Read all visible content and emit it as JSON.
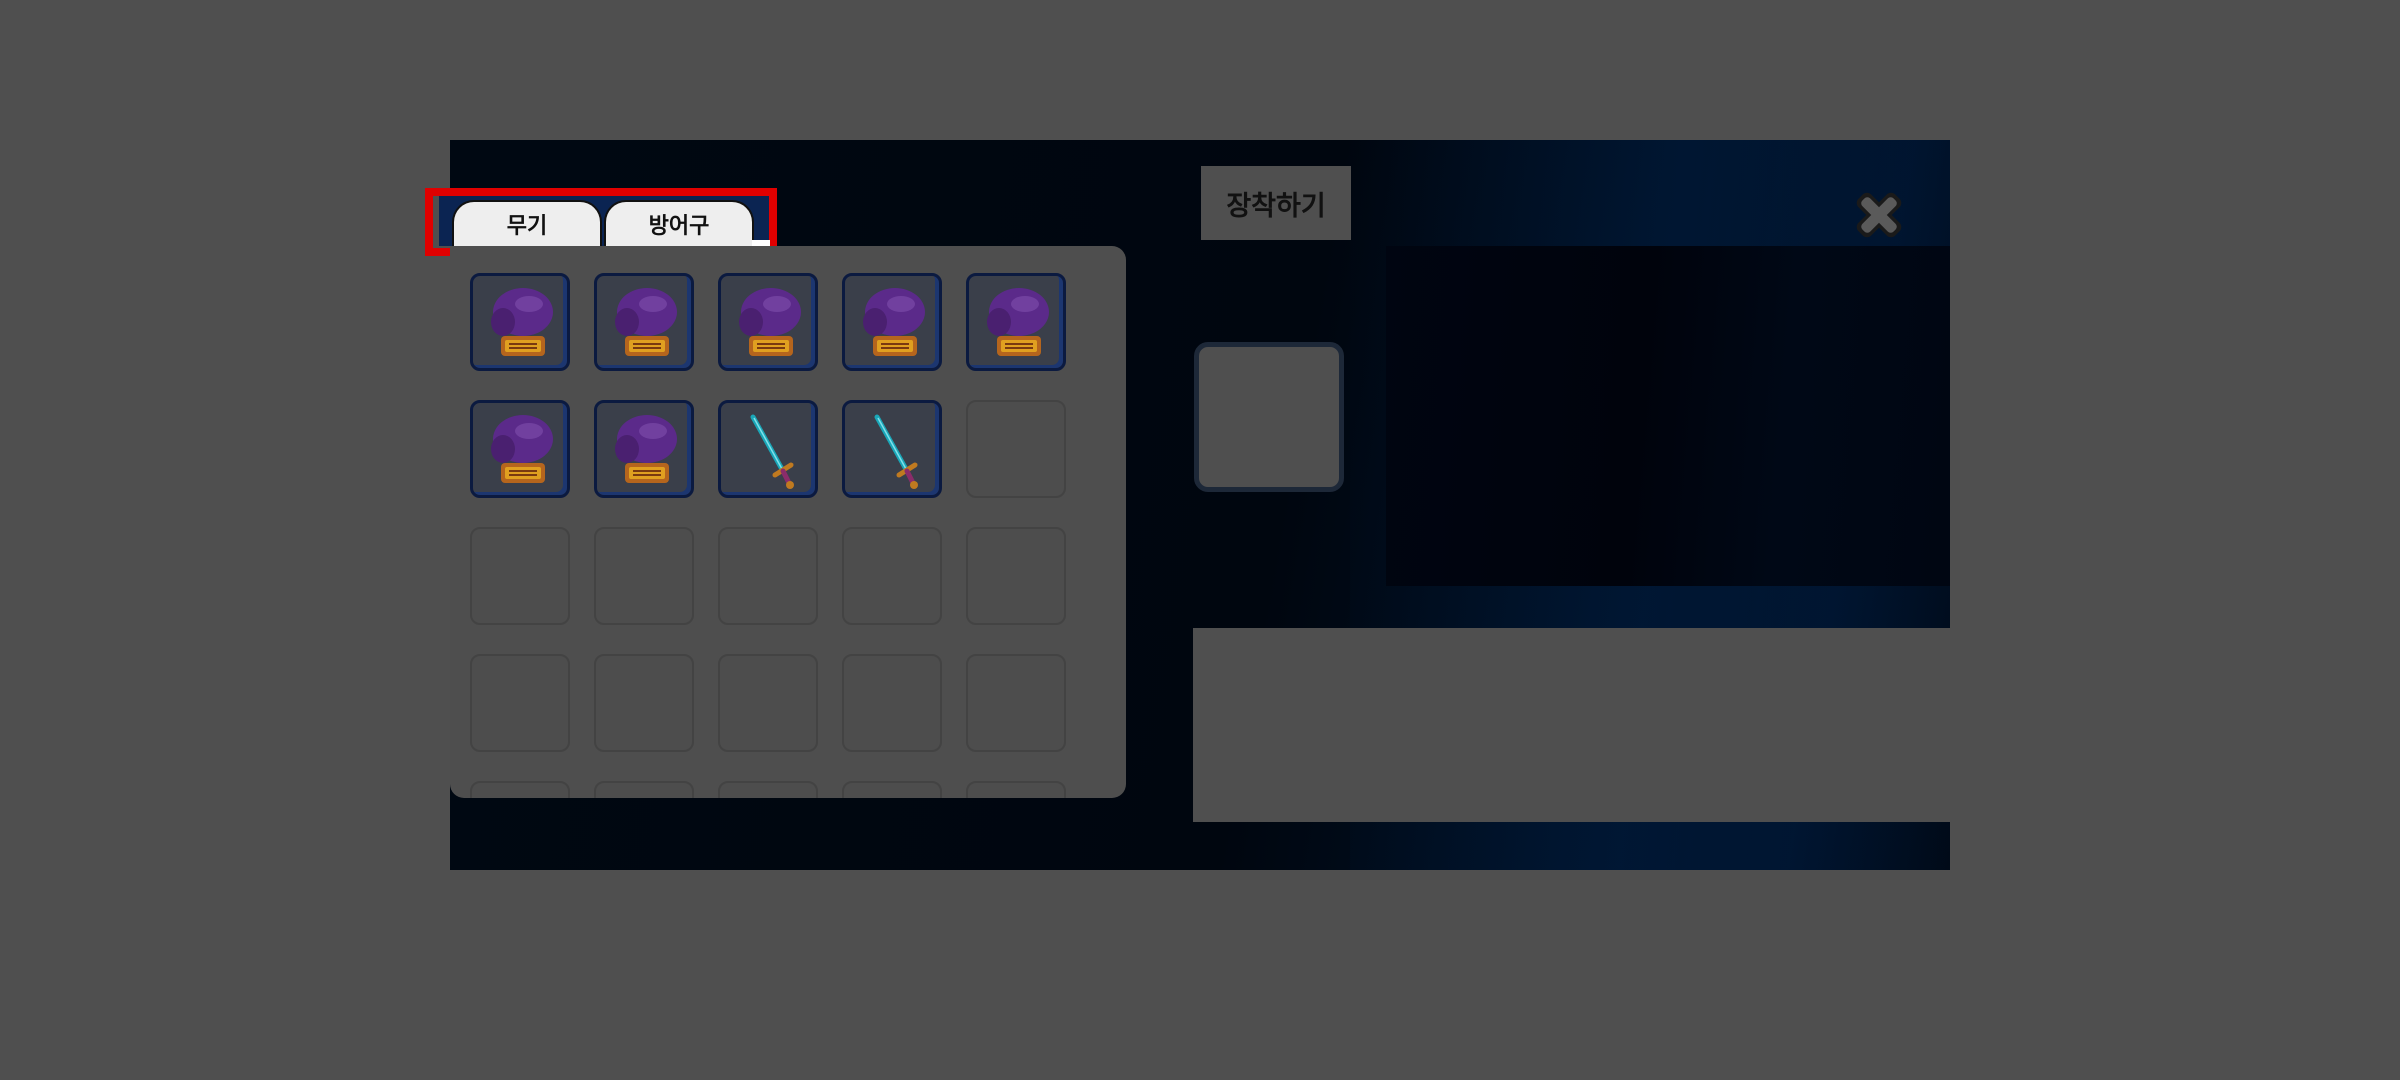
{
  "tabs": {
    "weapon_label": "무기",
    "armor_label": "방어구"
  },
  "equip_button_label": "장착하기",
  "colors": {
    "overlay": "#4f4f4f",
    "panel": "#000812",
    "tab_highlight": "#e00000",
    "glove": "#5b2a8a",
    "sword_blade": "#1aa7b8"
  },
  "inventory": {
    "columns": 5,
    "rows_visible": 4,
    "slots": [
      {
        "item": "glove-icon"
      },
      {
        "item": "glove-icon"
      },
      {
        "item": "glove-icon"
      },
      {
        "item": "glove-icon"
      },
      {
        "item": "glove-icon"
      },
      {
        "item": "glove-icon"
      },
      {
        "item": "glove-icon"
      },
      {
        "item": "sword-icon"
      },
      {
        "item": "sword-icon"
      },
      {
        "item": null
      },
      {
        "item": null
      },
      {
        "item": null
      },
      {
        "item": null
      },
      {
        "item": null
      },
      {
        "item": null
      },
      {
        "item": null
      },
      {
        "item": null
      },
      {
        "item": null
      },
      {
        "item": null
      },
      {
        "item": null
      },
      {
        "item": null
      },
      {
        "item": null
      },
      {
        "item": null
      },
      {
        "item": null
      },
      {
        "item": null
      }
    ]
  },
  "icons": {
    "close": "close-icon",
    "glove": "glove-icon",
    "sword": "sword-icon"
  }
}
